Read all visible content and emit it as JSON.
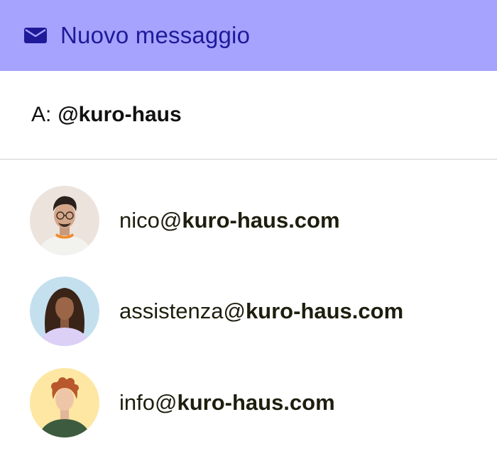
{
  "header": {
    "icon": "mail-icon",
    "title": "Nuovo messaggio",
    "background": "#a6a3ff",
    "text_color": "#1f1a99"
  },
  "to_field": {
    "label": "A:",
    "value": "@kuro-haus"
  },
  "contacts": [
    {
      "local": "nico@",
      "domain": "kuro-haus.com",
      "avatar_bg": "#ece3dc"
    },
    {
      "local": "assistenza@",
      "domain": "kuro-haus.com",
      "avatar_bg": "#c4e0ee"
    },
    {
      "local": "info@",
      "domain": "kuro-haus.com",
      "avatar_bg": "#fde7a3"
    }
  ]
}
